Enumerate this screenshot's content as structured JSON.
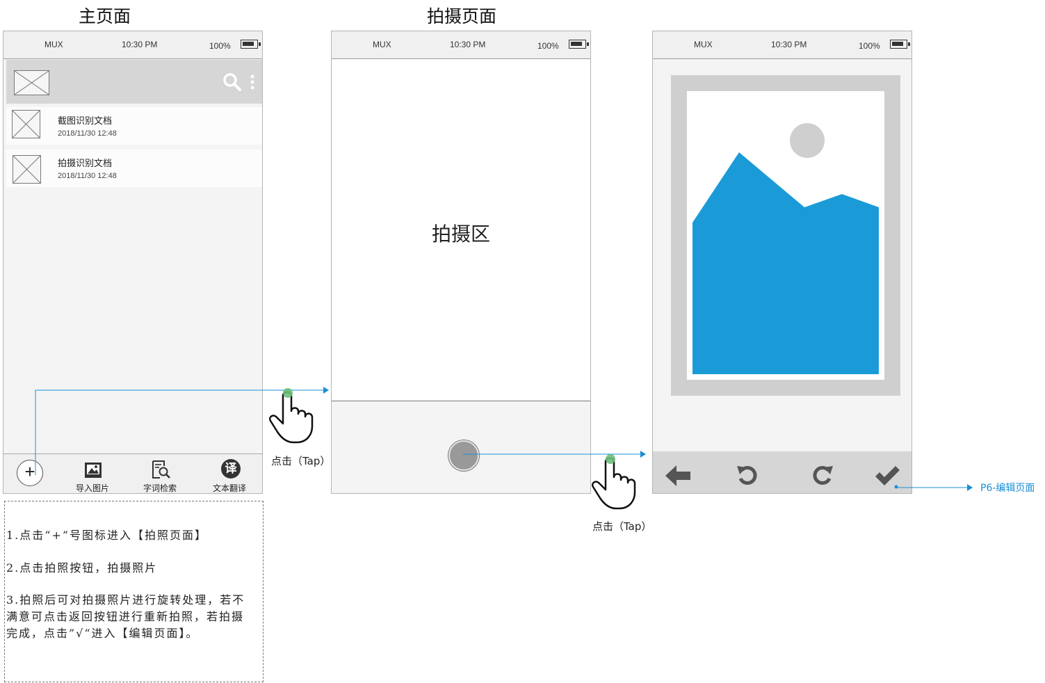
{
  "titles": {
    "main": "主页面",
    "capture": "拍摄页面"
  },
  "statusbar": {
    "carrier": "MUX",
    "time": "10:30 PM",
    "battery": "100%"
  },
  "home": {
    "items": [
      {
        "title": "截图识别文档",
        "date": "2018/11/30 12:48"
      },
      {
        "title": "拍摄识别文档",
        "date": "2018/11/30 12:48"
      }
    ],
    "nav": {
      "add": "+",
      "import": "导入图片",
      "search": "字词检索",
      "translate": "文本翻译",
      "translate_glyph": "译"
    }
  },
  "capture": {
    "area_label": "拍摄区"
  },
  "edit": {
    "link_label": "P6-编辑页面"
  },
  "taps": {
    "tap1": "点击（Tap）",
    "tap2": "点击（Tap）"
  },
  "notes": [
    "1.点击“+”号图标进入【拍照页面】",
    "2.点击拍照按钮，拍摄照片",
    "3.拍照后可对拍摄照片进行旋转处理，若不满意可点击返回按钮进行重新拍照，若拍摄完成，点击”√“进入【编辑页面】。"
  ],
  "colors": {
    "accent": "#1a8fd6",
    "image_fill": "#1a9bd7",
    "tap_dot": "#6cbf7a",
    "frame_gray": "#cfcfcf"
  }
}
